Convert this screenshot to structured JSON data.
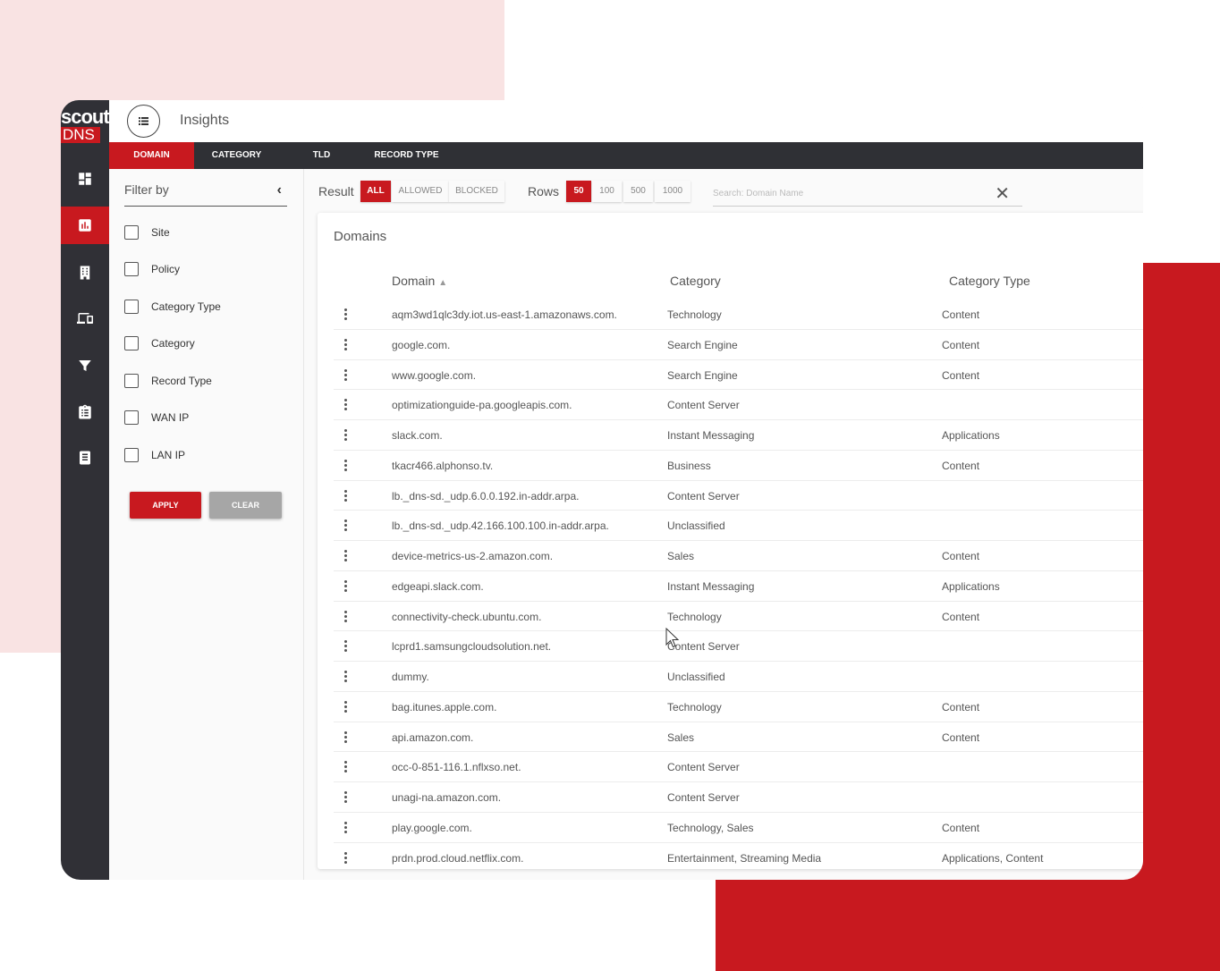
{
  "brand": {
    "logo_top": "scout",
    "logo_bottom": "DNS",
    "accent": "#c8191f",
    "dark": "#303036"
  },
  "sidebar": {
    "items": [
      {
        "icon": "dashboard-icon",
        "active": false
      },
      {
        "icon": "insights-chart-icon",
        "active": true
      },
      {
        "icon": "building-icon",
        "active": false
      },
      {
        "icon": "devices-icon",
        "active": false
      },
      {
        "icon": "filter-icon",
        "active": false
      },
      {
        "icon": "clipboard-icon",
        "active": false
      },
      {
        "icon": "book-icon",
        "active": false
      }
    ]
  },
  "header": {
    "title": "Insights",
    "menu_icon": "list-icon"
  },
  "tabs": [
    {
      "label": "DOMAIN",
      "active": true
    },
    {
      "label": "CATEGORY",
      "active": false
    },
    {
      "label": "TLD",
      "active": false
    },
    {
      "label": "RECORD TYPE",
      "active": false
    }
  ],
  "filter": {
    "title": "Filter by",
    "options": [
      "Site",
      "Policy",
      "Category Type",
      "Category",
      "Record Type",
      "WAN IP",
      "LAN IP"
    ],
    "apply_label": "APPLY",
    "clear_label": "CLEAR"
  },
  "controls": {
    "result_label": "Result",
    "result_options": [
      "ALL",
      "ALLOWED",
      "BLOCKED"
    ],
    "result_selected": "ALL",
    "rows_label": "Rows",
    "rows_options": [
      "50",
      "100",
      "500",
      "1000"
    ],
    "rows_selected": "50",
    "search_placeholder": "Search: Domain Name"
  },
  "table": {
    "title": "Domains",
    "columns": [
      "Domain",
      "Category",
      "Category Type"
    ],
    "rows": [
      [
        "aqm3wd1qlc3dy.iot.us-east-1.amazonaws.com.",
        "Technology",
        "Content"
      ],
      [
        "google.com.",
        "Search Engine",
        "Content"
      ],
      [
        "www.google.com.",
        "Search Engine",
        "Content"
      ],
      [
        "optimizationguide-pa.googleapis.com.",
        "Content Server",
        ""
      ],
      [
        "slack.com.",
        "Instant Messaging",
        "Applications"
      ],
      [
        "tkacr466.alphonso.tv.",
        "Business",
        "Content"
      ],
      [
        "lb._dns-sd._udp.6.0.0.192.in-addr.arpa.",
        "Content Server",
        ""
      ],
      [
        "lb._dns-sd._udp.42.166.100.100.in-addr.arpa.",
        "Unclassified",
        ""
      ],
      [
        "device-metrics-us-2.amazon.com.",
        "Sales",
        "Content"
      ],
      [
        "edgeapi.slack.com.",
        "Instant Messaging",
        "Applications"
      ],
      [
        "connectivity-check.ubuntu.com.",
        "Technology",
        "Content"
      ],
      [
        "lcprd1.samsungcloudsolution.net.",
        "Content Server",
        ""
      ],
      [
        "dummy.",
        "Unclassified",
        ""
      ],
      [
        "bag.itunes.apple.com.",
        "Technology",
        "Content"
      ],
      [
        "api.amazon.com.",
        "Sales",
        "Content"
      ],
      [
        "occ-0-851-116.1.nflxso.net.",
        "Content Server",
        ""
      ],
      [
        "unagi-na.amazon.com.",
        "Content Server",
        ""
      ],
      [
        "play.google.com.",
        "Technology, Sales",
        "Content"
      ],
      [
        "prdn.prod.cloud.netflix.com.",
        "Entertainment, Streaming Media",
        "Applications, Content"
      ]
    ]
  }
}
